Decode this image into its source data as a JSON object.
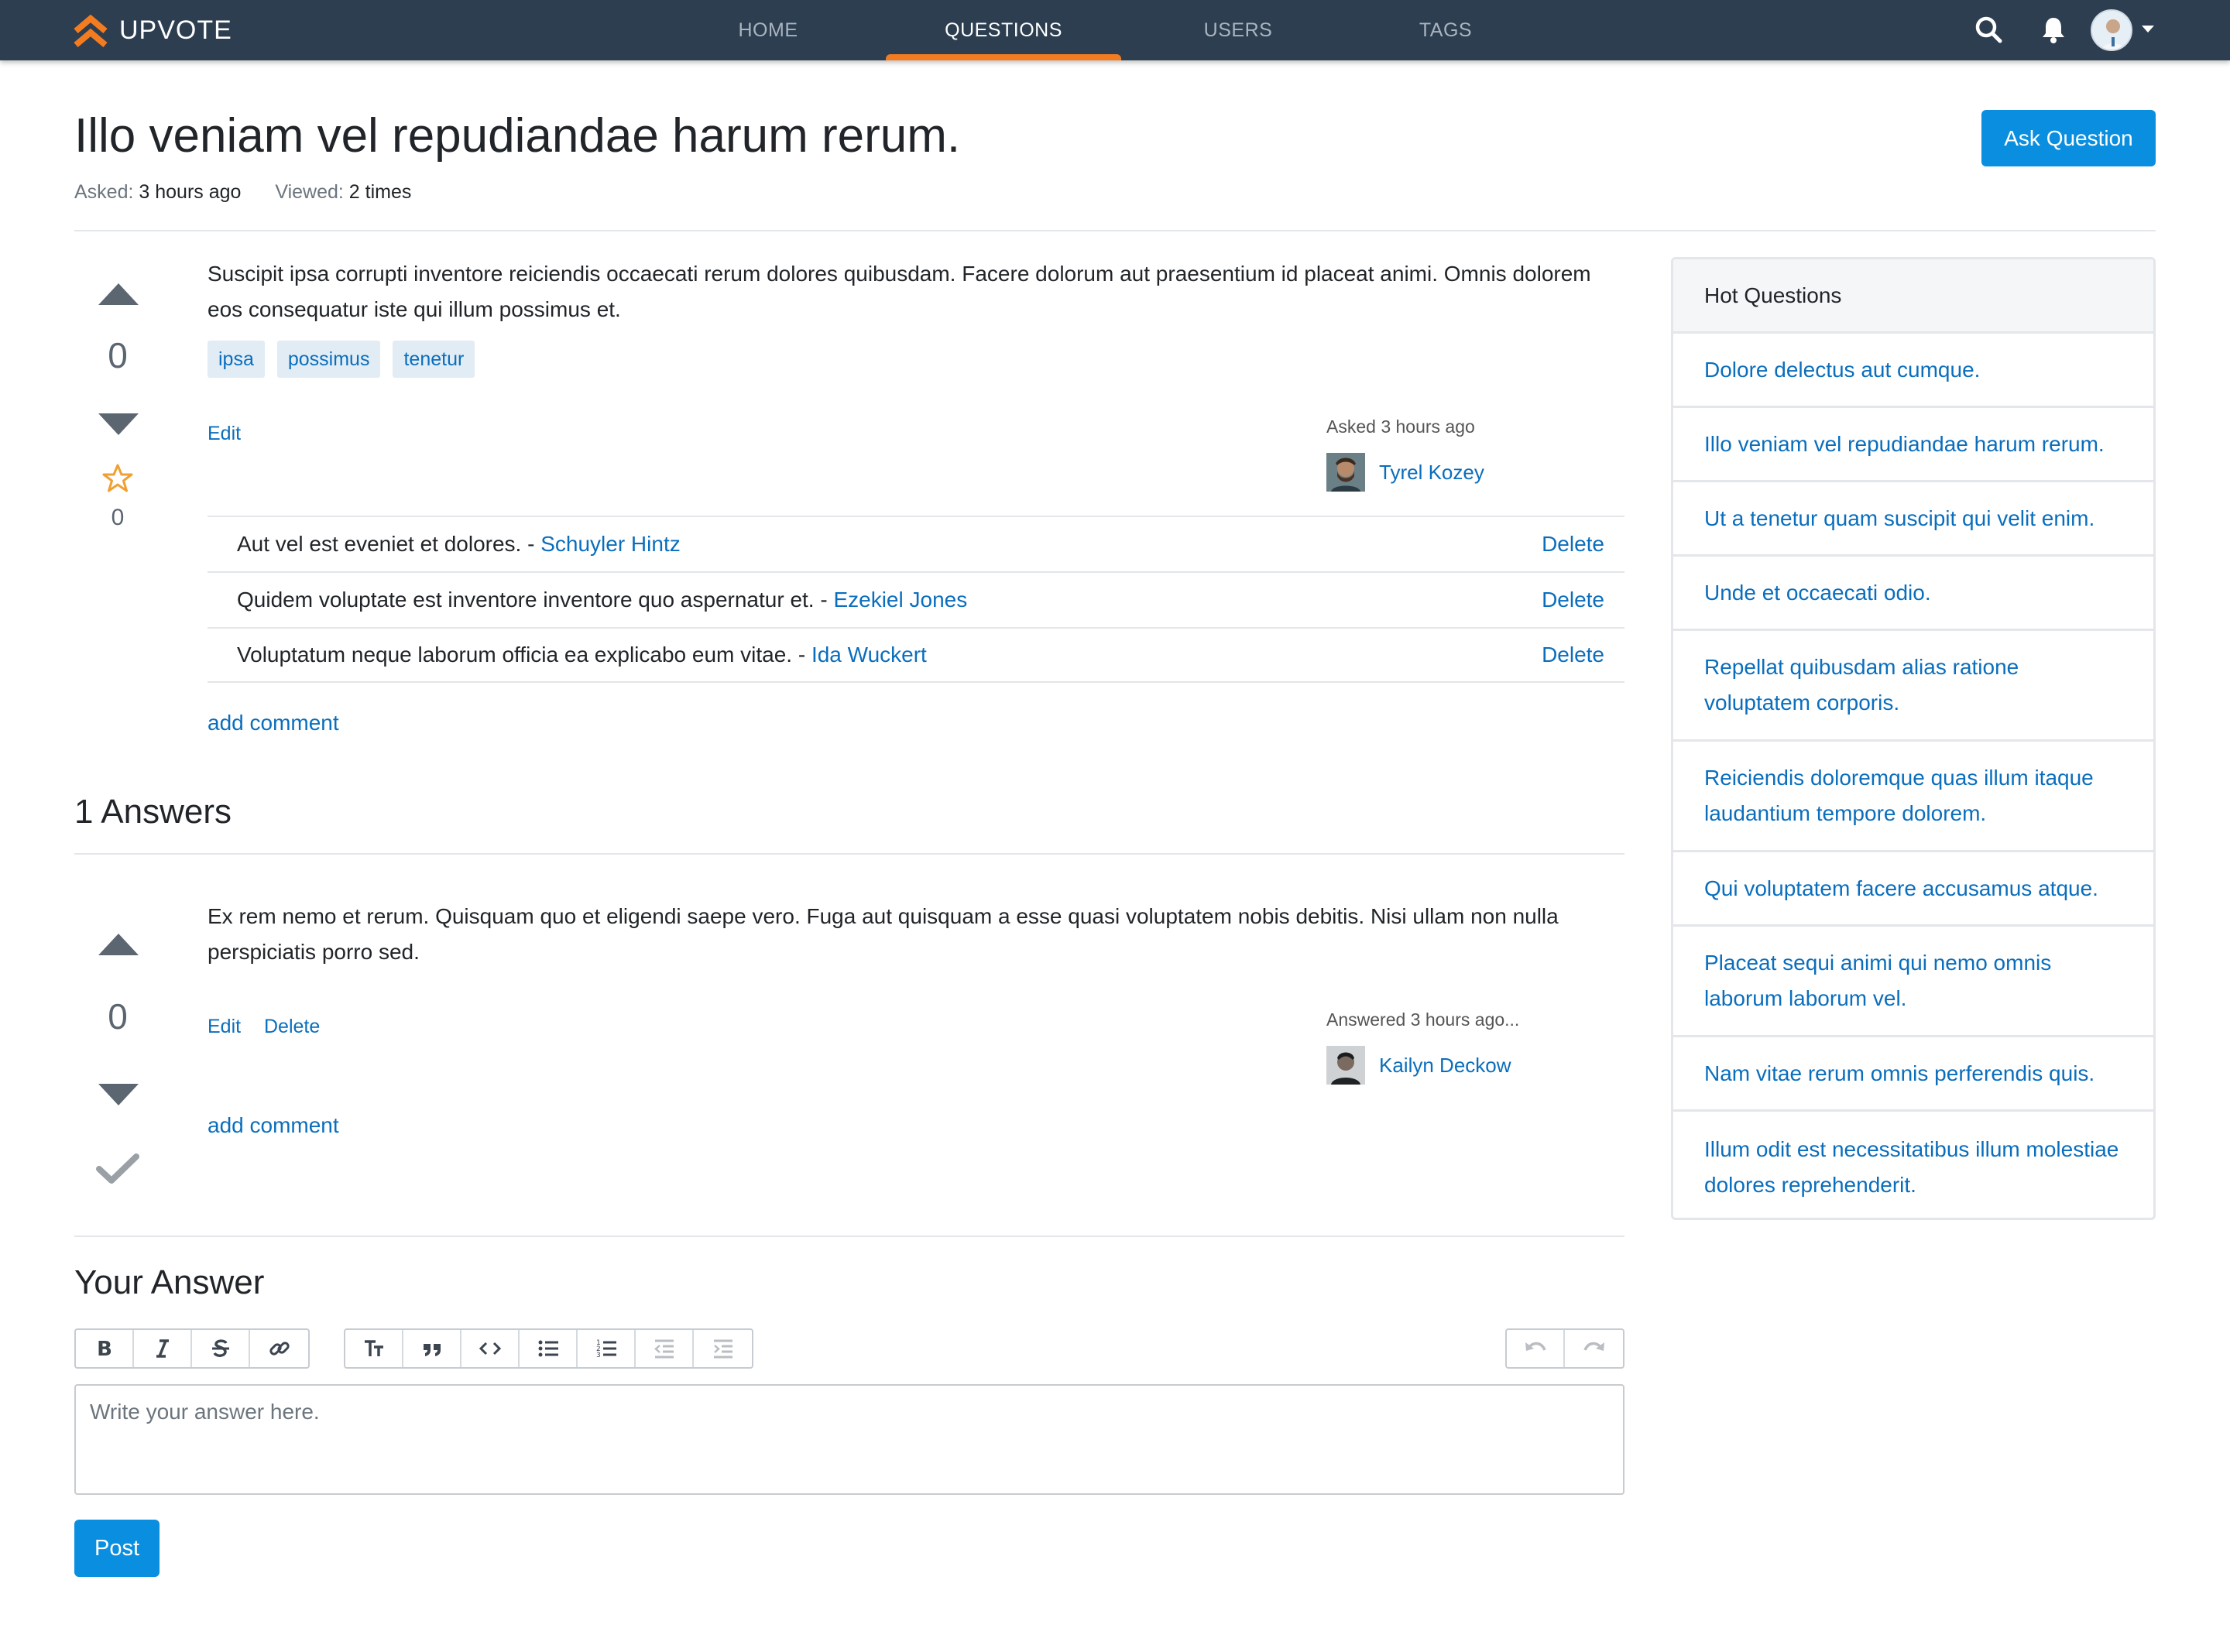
{
  "navbar": {
    "brand": "UPVOTE",
    "links": [
      {
        "label": "HOME",
        "active": false
      },
      {
        "label": "QUESTIONS",
        "active": true
      },
      {
        "label": "USERS",
        "active": false
      },
      {
        "label": "TAGS",
        "active": false
      }
    ],
    "icons": [
      "search-icon",
      "bell-icon",
      "user-avatar",
      "chevron-down-icon"
    ],
    "accent_color": "#f47c20",
    "bg_color": "#2c3e50"
  },
  "question": {
    "title": "Illo veniam vel repudiandae harum rerum.",
    "asked_label": "Asked:",
    "asked_value": "3 hours ago",
    "viewed_label": "Viewed:",
    "viewed_value": "2 times",
    "ask_button": "Ask Question",
    "votes": "0",
    "favorites": "0",
    "body": "Suscipit ipsa corrupti inventore reiciendis occaecati rerum dolores quibusdam. Facere dolorum aut praesentium id placeat animi. Omnis dolorem eos consequatur iste qui illum possimus et.",
    "tags": [
      "ipsa",
      "possimus",
      "tenetur"
    ],
    "edit_label": "Edit",
    "author_label": "Asked 3 hours ago",
    "author_name": "Tyrel Kozey",
    "comments": [
      {
        "text": "Aut vel est eveniet et dolores. - ",
        "user": "Schuyler Hintz",
        "action": "Delete"
      },
      {
        "text": "Quidem voluptate est inventore inventore quo aspernatur et. - ",
        "user": "Ezekiel Jones",
        "action": "Delete"
      },
      {
        "text": "Voluptatum neque laborum officia ea explicabo eum vitae. - ",
        "user": "Ida Wuckert",
        "action": "Delete"
      }
    ],
    "add_comment": "add comment"
  },
  "answers": {
    "title": "1 Answers",
    "items": [
      {
        "votes": "0",
        "body": "Ex rem nemo et rerum. Quisquam quo et eligendi saepe vero. Fuga aut quisquam a esse quasi voluptatem nobis debitis. Nisi ullam non nulla perspiciatis porro sed.",
        "edit_label": "Edit",
        "delete_label": "Delete",
        "author_label": "Answered 3 hours ago...",
        "author_name": "Kailyn Deckow",
        "add_comment": "add comment"
      }
    ]
  },
  "your_answer": {
    "title": "Your Answer",
    "toolbar_groups": [
      [
        "bold-icon",
        "italic-icon",
        "strikethrough-icon",
        "link-icon"
      ],
      [
        "heading-icon",
        "quote-icon",
        "code-icon",
        "bullet-list-icon",
        "numbered-list-icon",
        "outdent-icon",
        "indent-icon"
      ],
      [
        "undo-icon",
        "redo-icon"
      ]
    ],
    "placeholder": "Write your answer here.",
    "post_button": "Post"
  },
  "sidebar": {
    "title": "Hot Questions",
    "items": [
      "Dolore delectus aut cumque.",
      "Illo veniam vel repudiandae harum rerum.",
      "Ut a tenetur quam suscipit qui velit enim.",
      "Unde et occaecati odio.",
      "Repellat quibusdam alias ratione voluptatem corporis.",
      "Reiciendis doloremque quas illum itaque laudantium tempore dolorem.",
      "Qui voluptatem facere accusamus atque.",
      "Placeat sequi animi qui nemo omnis laborum laborum vel.",
      "Nam vitae rerum omnis perferendis quis.",
      "Illum odit est necessitatibus illum molestiae dolores reprehenderit."
    ]
  },
  "colors": {
    "primary": "#0a8fe0",
    "link": "#0a6ebd",
    "favorite_star": "#f0a033",
    "tag_bg": "#e1ecf4"
  }
}
